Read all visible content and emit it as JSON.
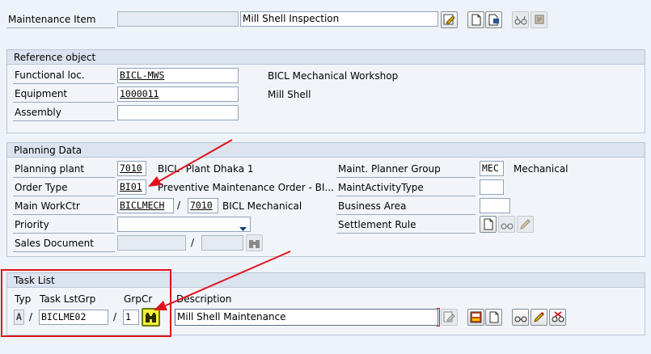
{
  "header": {
    "maintenance_item_label": "Maintenance Item",
    "maintenance_item_value": "",
    "maintenance_item_text": "Mill Shell Inspection"
  },
  "reference_object": {
    "title": "Reference object",
    "functional_loc_label": "Functional loc.",
    "functional_loc_value": "BICL-MWS",
    "functional_loc_desc": "BICL Mechanical Workshop",
    "equipment_label": "Equipment",
    "equipment_value": "1000011",
    "equipment_desc": "Mill Shell",
    "assembly_label": "Assembly",
    "assembly_value": ""
  },
  "planning_data": {
    "title": "Planning Data",
    "planning_plant_label": "Planning plant",
    "planning_plant_value": "7010",
    "planning_plant_desc": "BICL- Plant Dhaka 1",
    "order_type_label": "Order Type",
    "order_type_value": "BI01",
    "order_type_desc": "Preventive Maintenance Order - BI...",
    "main_workctr_label": "Main WorkCtr",
    "main_workctr_value": "BICLMECH",
    "main_workctr_sep": "/",
    "main_workctr_plant": "7010",
    "main_workctr_desc": "BICL Mechanical",
    "priority_label": "Priority",
    "priority_value": "",
    "sales_document_label": "Sales Document",
    "sales_document_value": "",
    "sales_document_sep": "/",
    "sales_item_value": "",
    "planner_group_label": "Maint. Planner Group",
    "planner_group_value": "MEC",
    "planner_group_desc": "Mechanical",
    "activity_type_label": "MaintActivityType",
    "activity_type_value": "",
    "business_area_label": "Business Area",
    "business_area_value": "",
    "settlement_rule_label": "Settlement Rule"
  },
  "task_list": {
    "title": "Task List",
    "col_typ": "Typ",
    "col_grp": "Task LstGrp",
    "col_grpcr": "GrpCr",
    "col_desc": "Description",
    "typ_value": "A",
    "sep1": "/",
    "group_value": "BICLME02",
    "sep2": "/",
    "grpcr_value": "1",
    "description_value": "Mill Shell Maintenance"
  },
  "colors": {
    "annotation_red": "#e0131b",
    "highlight_button": "#f2f23a"
  }
}
